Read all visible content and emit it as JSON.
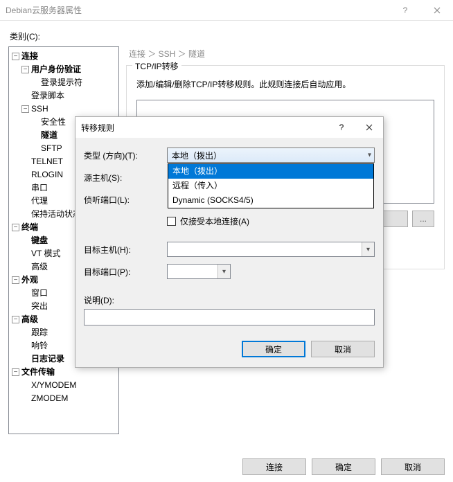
{
  "window_title": "Debian云服务器属性",
  "category_label": "类别(C):",
  "breadcrumb": "连接 ＞ SSH ＞ 隧道",
  "group": {
    "title": "TCP/IP转移",
    "desc": "添加/编辑/删除TCP/IP转移规则。此规则连接后自动应用。",
    "btn_more": "...",
    "btn_more2": "..."
  },
  "footer": {
    "connect": "连接",
    "ok": "确定",
    "cancel": "取消"
  },
  "tree": {
    "connection": "连接",
    "auth": "用户身份验证",
    "login_prompt": "登录提示符",
    "login_script": "登录脚本",
    "ssh": "SSH",
    "security": "安全性",
    "tunnel": "隧道",
    "sftp": "SFTP",
    "telnet": "TELNET",
    "rlogin": "RLOGIN",
    "serial": "串口",
    "proxy": "代理",
    "keepalive": "保持活动状态",
    "terminal": "终端",
    "keyboard": "键盘",
    "vtmode": "VT 模式",
    "advanced_t": "高级",
    "appearance": "外观",
    "window": "窗口",
    "highlight": "突出",
    "advanced": "高级",
    "trace": "跟踪",
    "bell": "响铃",
    "log": "日志记录",
    "filetransfer": "文件传输",
    "xymodem": "X/YMODEM",
    "zmodem": "ZMODEM"
  },
  "dialog": {
    "title": "转移规则",
    "help": "?",
    "type_label": "类型 (方向)(T):",
    "type_value": "本地（拨出）",
    "type_options": {
      "local": "本地（拨出）",
      "remote": "远程（传入）",
      "dynamic": "Dynamic (SOCKS4/5)"
    },
    "src_host_label": "源主机(S):",
    "listen_port_label": "侦听端口(L):",
    "accept_local_label": "仅接受本地连接(A)",
    "dest_host_label": "目标主机(H):",
    "dest_port_label": "目标端口(P):",
    "desc_label": "说明(D):",
    "ok": "确定",
    "cancel": "取消"
  }
}
